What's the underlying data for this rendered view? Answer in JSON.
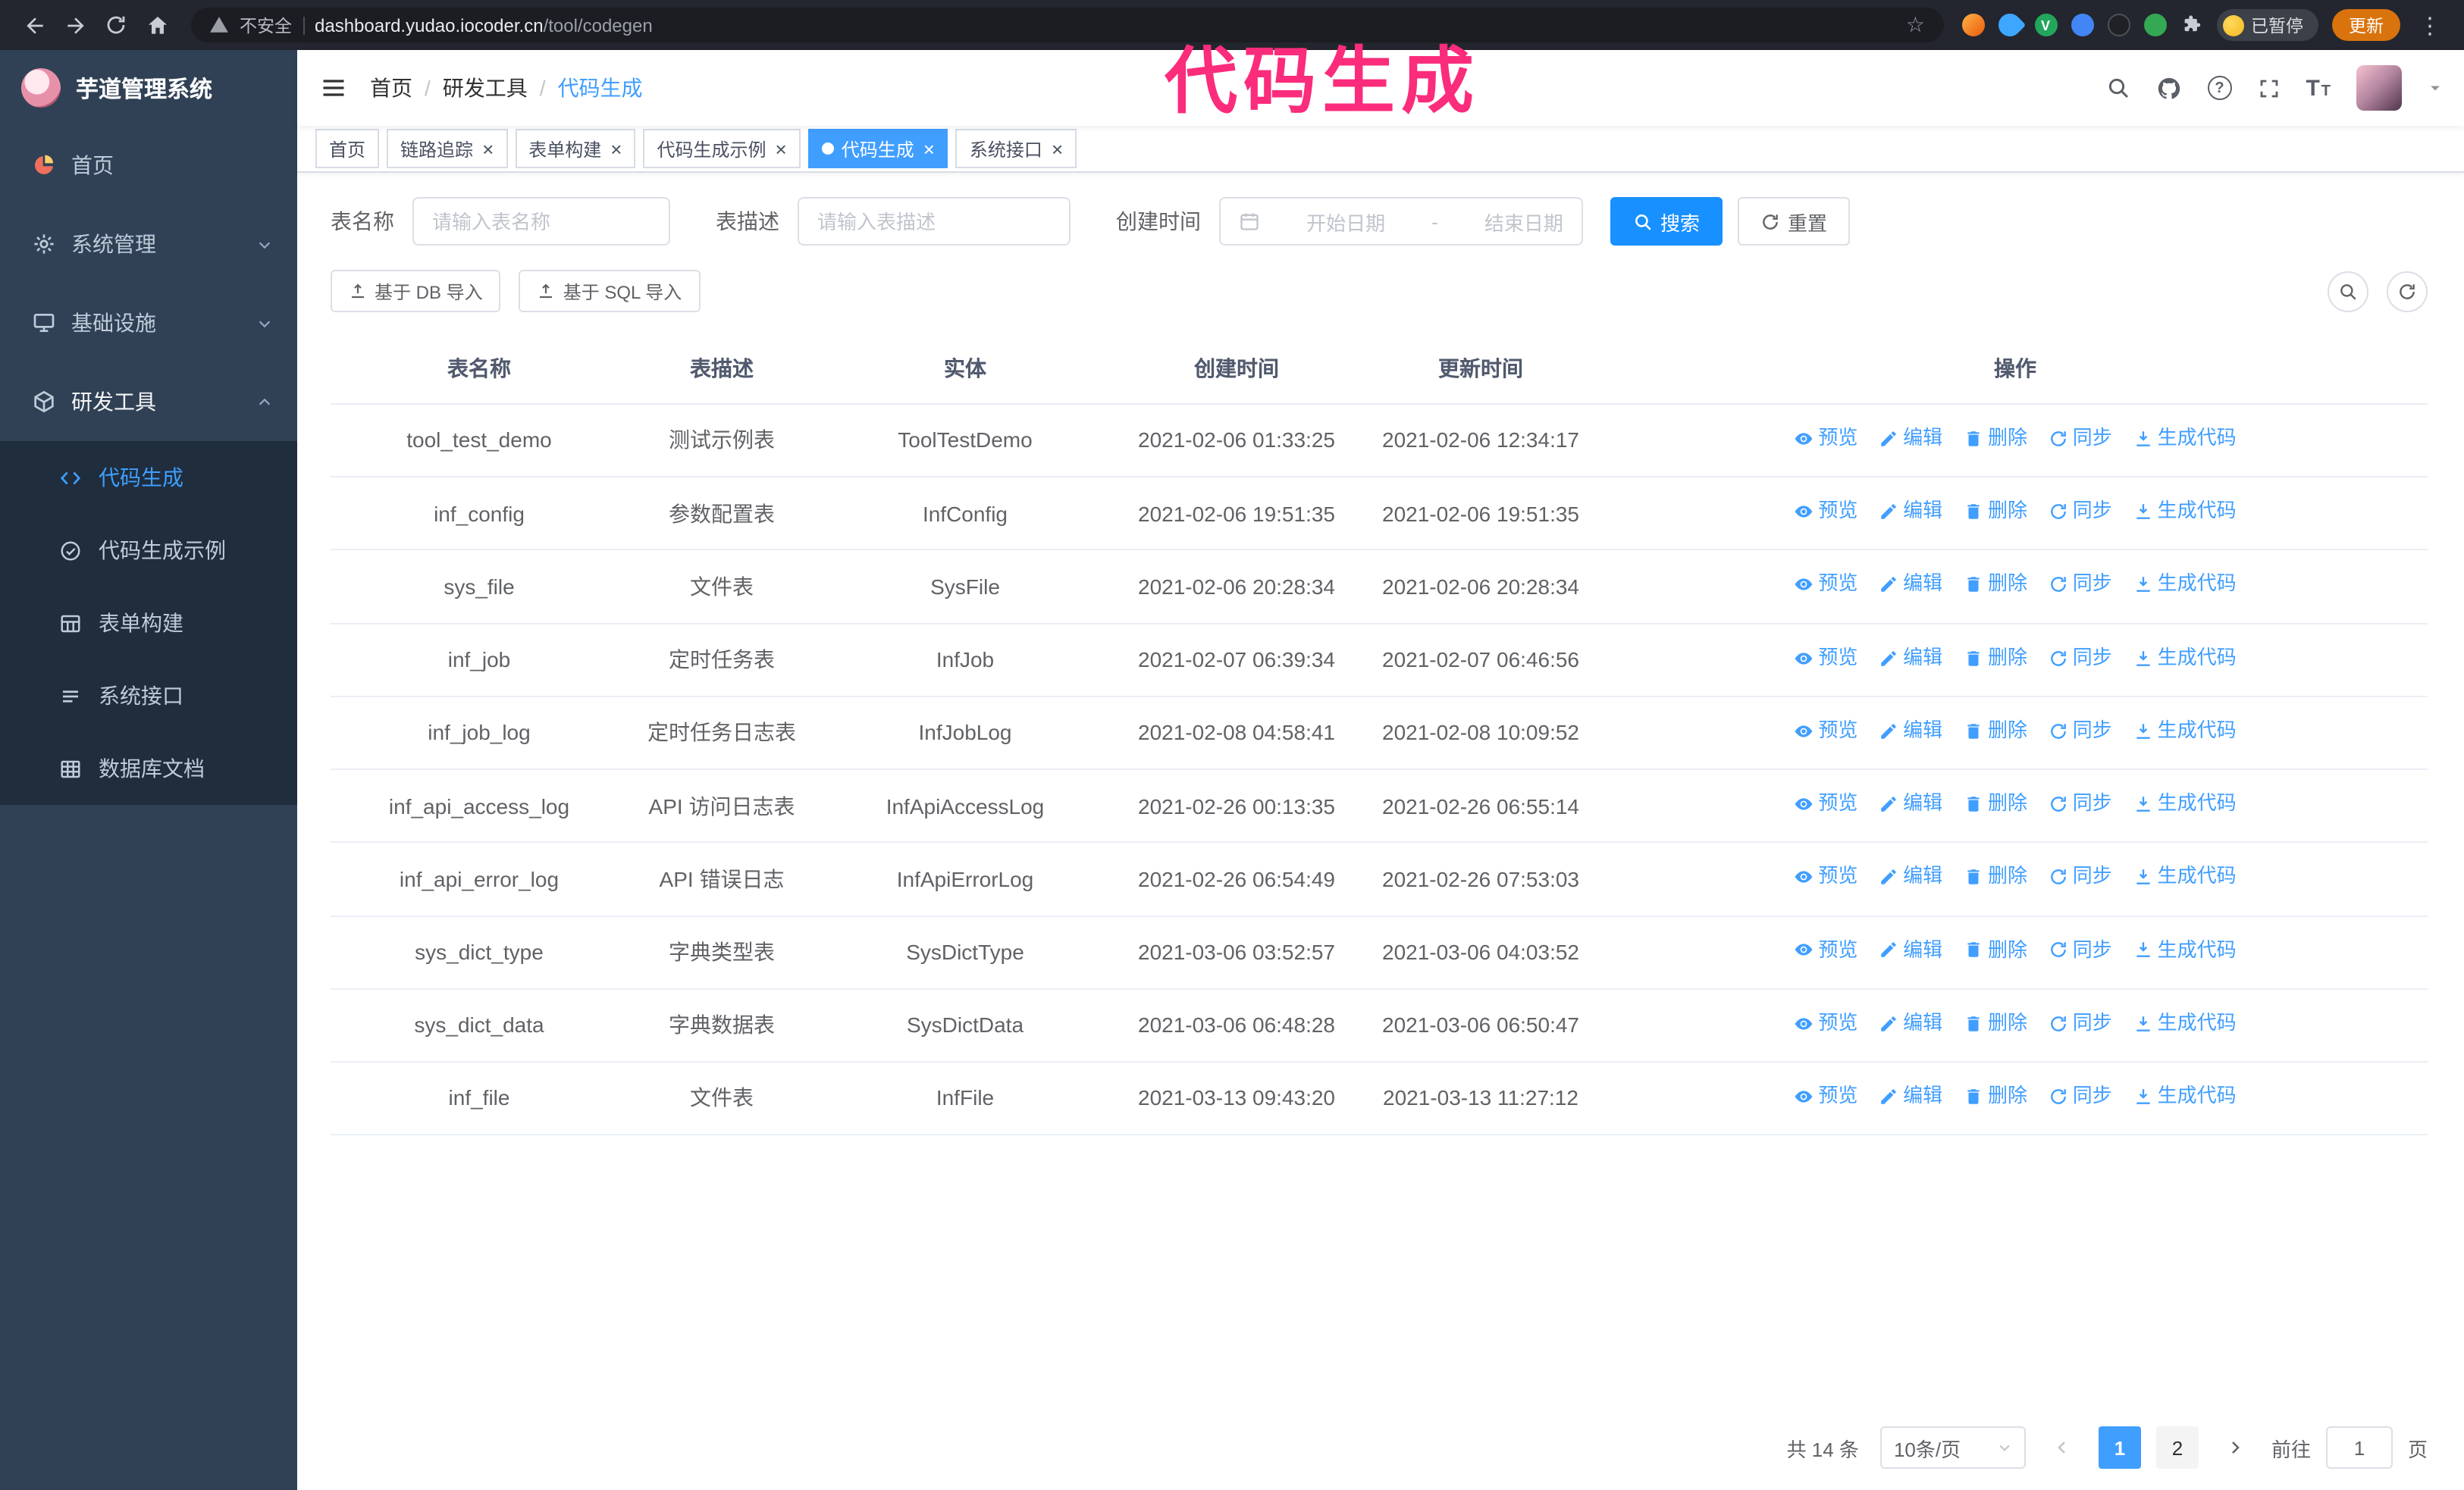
{
  "colors": {
    "accent": "#409eff",
    "primary_button": "#1890ff",
    "sidebar_bg": "#304156",
    "submenu_bg": "#1f2d3d",
    "active_tab_bg": "#409eff",
    "annotation": "#fa2c7b",
    "link": "#409eff"
  },
  "icons": {
    "close": "×",
    "more": "⋮",
    "star": "☆",
    "help": "?",
    "font_size_large": "T",
    "font_size_small": "T"
  },
  "browser": {
    "security_label": "不安全",
    "url_domain": "dashboard.yudao.iocoder.cn",
    "url_path": "/tool/codegen",
    "paused_badge": "已暂停",
    "update_button": "更新"
  },
  "annotation": {
    "text": "代码生成"
  },
  "sidebar": {
    "app_title": "芋道管理系统",
    "items": [
      {
        "label": "首页"
      },
      {
        "label": "系统管理"
      },
      {
        "label": "基础设施"
      },
      {
        "label": "研发工具"
      }
    ],
    "submenu": [
      {
        "label": "代码生成"
      },
      {
        "label": "代码生成示例"
      },
      {
        "label": "表单构建"
      },
      {
        "label": "系统接口"
      },
      {
        "label": "数据库文档"
      }
    ]
  },
  "navbar": {
    "breadcrumb": [
      "首页",
      "研发工具",
      "代码生成"
    ],
    "separator": "/"
  },
  "tabs": [
    {
      "label": "首页"
    },
    {
      "label": "链路追踪"
    },
    {
      "label": "表单构建"
    },
    {
      "label": "代码生成示例"
    },
    {
      "label": "代码生成"
    },
    {
      "label": "系统接口"
    }
  ],
  "filters": {
    "table_name_label": "表名称",
    "table_name_placeholder": "请输入表名称",
    "table_desc_label": "表描述",
    "table_desc_placeholder": "请输入表描述",
    "create_time_label": "创建时间",
    "date_start_placeholder": "开始日期",
    "date_separator": "-",
    "date_end_placeholder": "结束日期",
    "search_button": "搜索",
    "reset_button": "重置"
  },
  "toolbar": {
    "import_db_button": "基于 DB 导入",
    "import_sql_button": "基于 SQL 导入"
  },
  "table": {
    "columns": [
      "表名称",
      "表描述",
      "实体",
      "创建时间",
      "更新时间",
      "操作"
    ],
    "actions": [
      "预览",
      "编辑",
      "删除",
      "同步",
      "生成代码"
    ],
    "rows": [
      {
        "name": "tool_test_demo",
        "desc": "测试示例表",
        "entity": "ToolTestDemo",
        "created": "2021-02-06 01:33:25",
        "updated": "2021-02-06 12:34:17"
      },
      {
        "name": "inf_config",
        "desc": "参数配置表",
        "entity": "InfConfig",
        "created": "2021-02-06 19:51:35",
        "updated": "2021-02-06 19:51:35"
      },
      {
        "name": "sys_file",
        "desc": "文件表",
        "entity": "SysFile",
        "created": "2021-02-06 20:28:34",
        "updated": "2021-02-06 20:28:34"
      },
      {
        "name": "inf_job",
        "desc": "定时任务表",
        "entity": "InfJob",
        "created": "2021-02-07 06:39:34",
        "updated": "2021-02-07 06:46:56"
      },
      {
        "name": "inf_job_log",
        "desc": "定时任务日志表",
        "entity": "InfJobLog",
        "created": "2021-02-08 04:58:41",
        "updated": "2021-02-08 10:09:52"
      },
      {
        "name": "inf_api_access_log",
        "desc": "API 访问日志表",
        "entity": "InfApiAccessLog",
        "created": "2021-02-26 00:13:35",
        "updated": "2021-02-26 06:55:14"
      },
      {
        "name": "inf_api_error_log",
        "desc": "API 错误日志",
        "entity": "InfApiErrorLog",
        "created": "2021-02-26 06:54:49",
        "updated": "2021-02-26 07:53:03"
      },
      {
        "name": "sys_dict_type",
        "desc": "字典类型表",
        "entity": "SysDictType",
        "created": "2021-03-06 03:52:57",
        "updated": "2021-03-06 04:03:52"
      },
      {
        "name": "sys_dict_data",
        "desc": "字典数据表",
        "entity": "SysDictData",
        "created": "2021-03-06 06:48:28",
        "updated": "2021-03-06 06:50:47"
      },
      {
        "name": "inf_file",
        "desc": "文件表",
        "entity": "InfFile",
        "created": "2021-03-13 09:43:20",
        "updated": "2021-03-13 11:27:12"
      }
    ]
  },
  "pagination": {
    "total": "共 14 条",
    "page_size": "10条/页",
    "pages": [
      "1",
      "2"
    ],
    "goto_label": "前往",
    "goto_value": "1",
    "goto_suffix": "页"
  }
}
